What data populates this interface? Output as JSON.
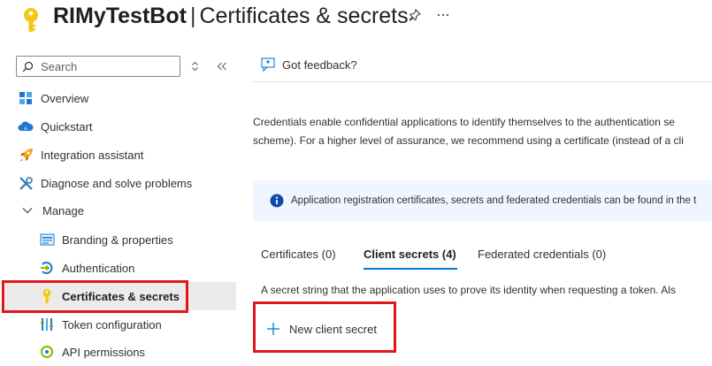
{
  "header": {
    "app_name": "RIMyTestBot",
    "separator": "|",
    "page_title": "Certificates & secrets",
    "pin_icon": "pin-icon",
    "more_icon": "ellipsis-icon"
  },
  "sidebar": {
    "search_placeholder": "Search",
    "items": [
      {
        "label": "Overview",
        "icon": "overview-grid-icon"
      },
      {
        "label": "Quickstart",
        "icon": "cloud-icon"
      },
      {
        "label": "Integration assistant",
        "icon": "rocket-icon"
      },
      {
        "label": "Diagnose and solve problems",
        "icon": "wrench-icon"
      },
      {
        "label": "Manage",
        "icon": "chevron-down-icon"
      },
      {
        "label": "Branding & properties",
        "icon": "branding-icon"
      },
      {
        "label": "Authentication",
        "icon": "authentication-icon"
      },
      {
        "label": "Certificates & secrets",
        "icon": "key-icon"
      },
      {
        "label": "Token configuration",
        "icon": "token-icon"
      },
      {
        "label": "API permissions",
        "icon": "api-icon"
      }
    ]
  },
  "main": {
    "feedback_label": "Got feedback?",
    "description_line1": "Credentials enable confidential applications to identify themselves to the authentication se",
    "description_line2": "scheme). For a higher level of assurance, we recommend using a certificate (instead of a cli",
    "info_text": "Application registration certificates, secrets and federated credentials can be found in the t",
    "tabs": [
      {
        "label": "Certificates (0)"
      },
      {
        "label": "Client secrets (4)"
      },
      {
        "label": "Federated credentials (0)"
      }
    ],
    "secret_description": "A secret string that the application uses to prove its identity when requesting a token. Als",
    "new_secret_label": "New client secret"
  },
  "colors": {
    "accent": "#0078d4",
    "highlight": "#e0161b",
    "key": "#f2c811",
    "info_bg": "#f0f6ff"
  }
}
